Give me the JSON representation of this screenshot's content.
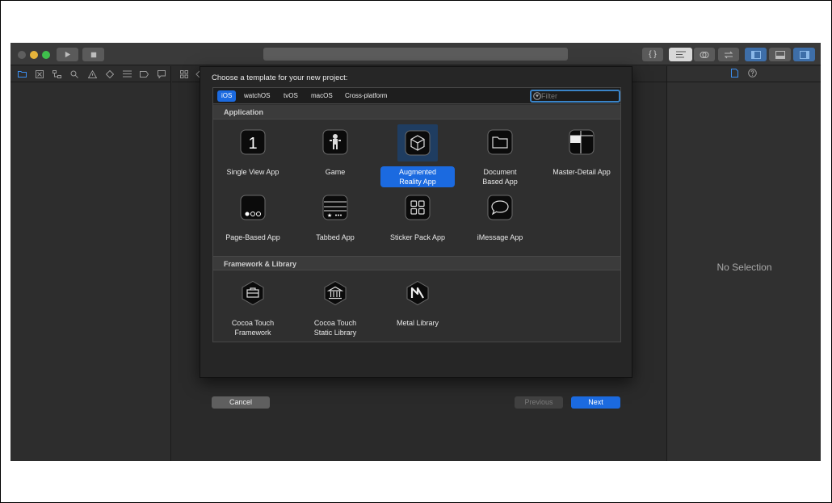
{
  "toolbar": {
    "left_bracket": "{ }"
  },
  "inspector": {
    "no_selection": "No Selection"
  },
  "dialog": {
    "title": "Choose a template for your new project:",
    "tabs": [
      "iOS",
      "watchOS",
      "tvOS",
      "macOS",
      "Cross-platform"
    ],
    "active_tab": "iOS",
    "filter_placeholder": "Filter",
    "sections": {
      "application": {
        "title": "Application",
        "templates": [
          {
            "label": "Single View App",
            "icon": "single-view-icon"
          },
          {
            "label": "Game",
            "icon": "game-icon"
          },
          {
            "label": "Augmented\nReality App",
            "icon": "ar-cube-icon",
            "selected": true
          },
          {
            "label": "Document\nBased App",
            "icon": "folder-icon"
          },
          {
            "label": "Master-Detail App",
            "icon": "master-detail-icon"
          },
          {
            "label": "Page-Based App",
            "icon": "page-dots-icon"
          },
          {
            "label": "Tabbed App",
            "icon": "tab-bar-icon"
          },
          {
            "label": "Sticker Pack App",
            "icon": "sticker-grid-icon"
          },
          {
            "label": "iMessage App",
            "icon": "speech-bubble-icon"
          }
        ]
      },
      "framework": {
        "title": "Framework & Library",
        "templates": [
          {
            "label": "Cocoa Touch\nFramework",
            "icon": "toolbox-icon"
          },
          {
            "label": "Cocoa Touch\nStatic Library",
            "icon": "library-building-icon"
          },
          {
            "label": "Metal Library",
            "icon": "metal-icon"
          }
        ]
      }
    },
    "buttons": {
      "cancel": "Cancel",
      "previous": "Previous",
      "next": "Next"
    }
  },
  "colors": {
    "accent": "#1b6ae0",
    "window_bg": "#2b2b2b",
    "sheet_bg": "#262626"
  }
}
